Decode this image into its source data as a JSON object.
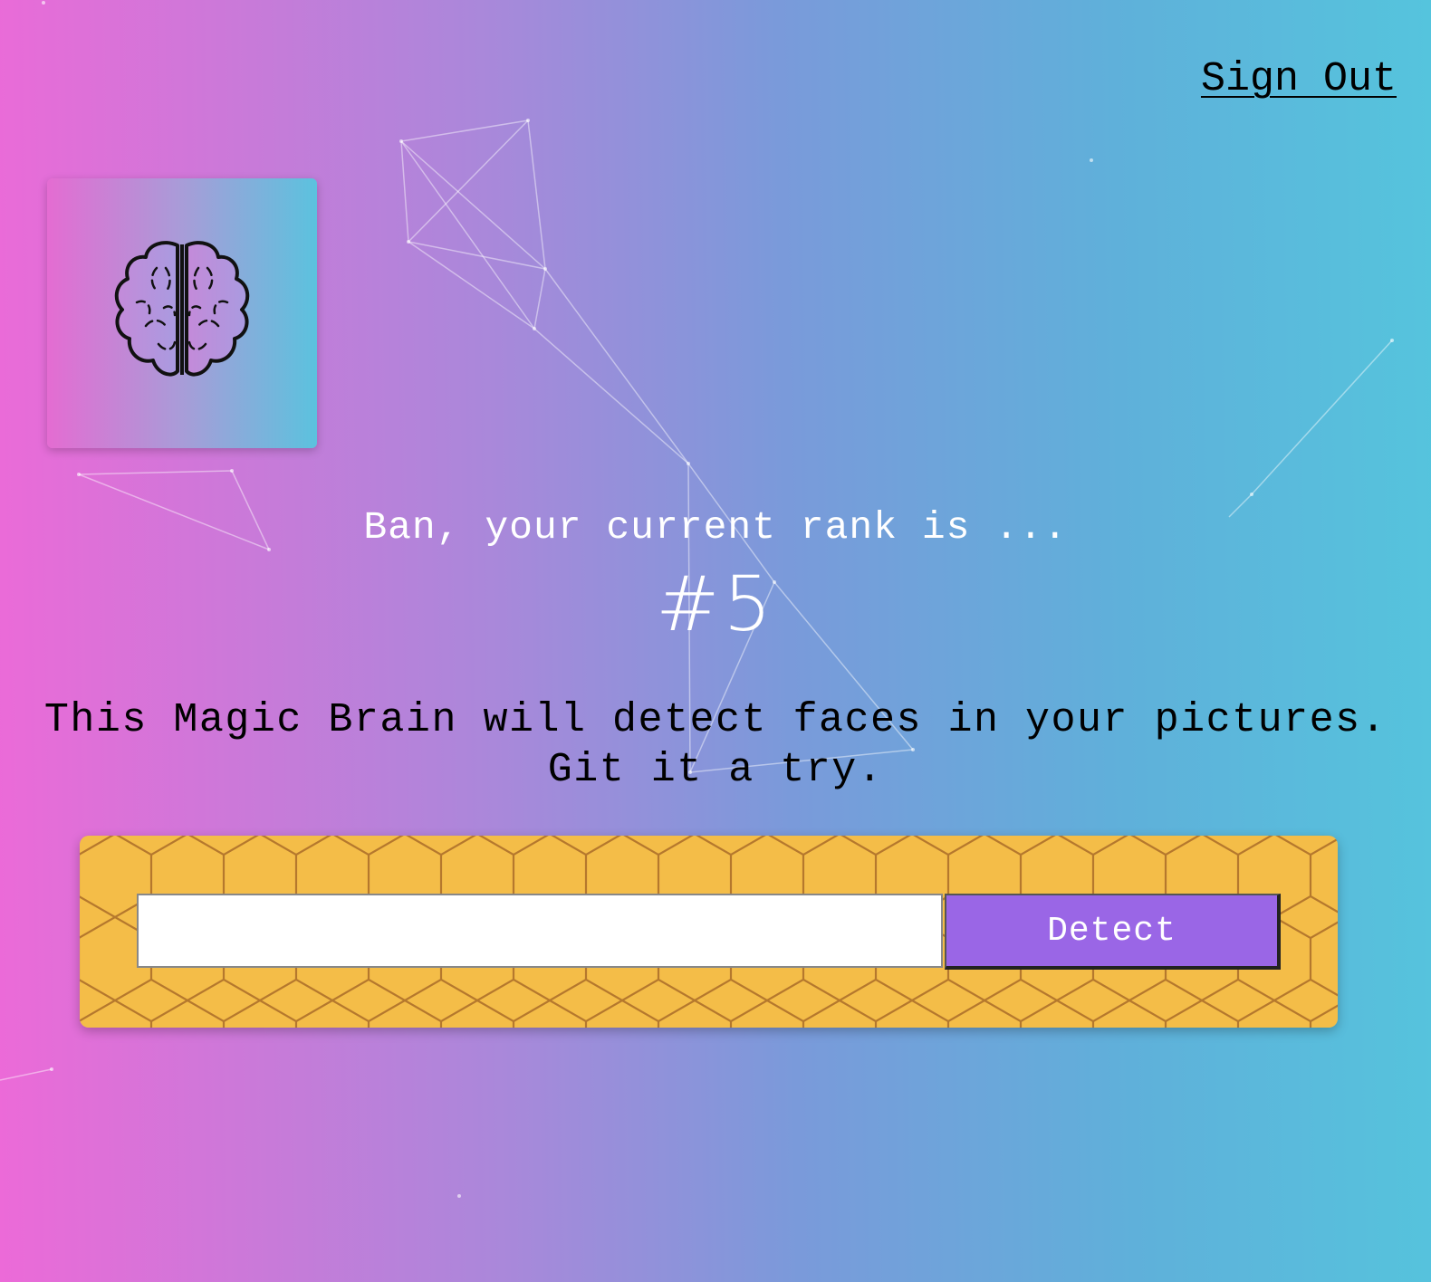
{
  "nav": {
    "sign_out_label": "Sign Out"
  },
  "logo": {
    "icon": "brain-icon"
  },
  "rank": {
    "message": "Ban, your current rank is ...",
    "value": "#5"
  },
  "intro": {
    "line1": "This Magic Brain will detect faces in your pictures.",
    "line2": "Git it a try."
  },
  "form": {
    "input_value": "",
    "input_placeholder": "",
    "detect_label": "Detect"
  },
  "colors": {
    "gradient_left": "#ec6ad8",
    "gradient_right": "#55c4dd",
    "panel_honeycomb": "#f4bd48",
    "detect_button": "#9a66e6"
  }
}
